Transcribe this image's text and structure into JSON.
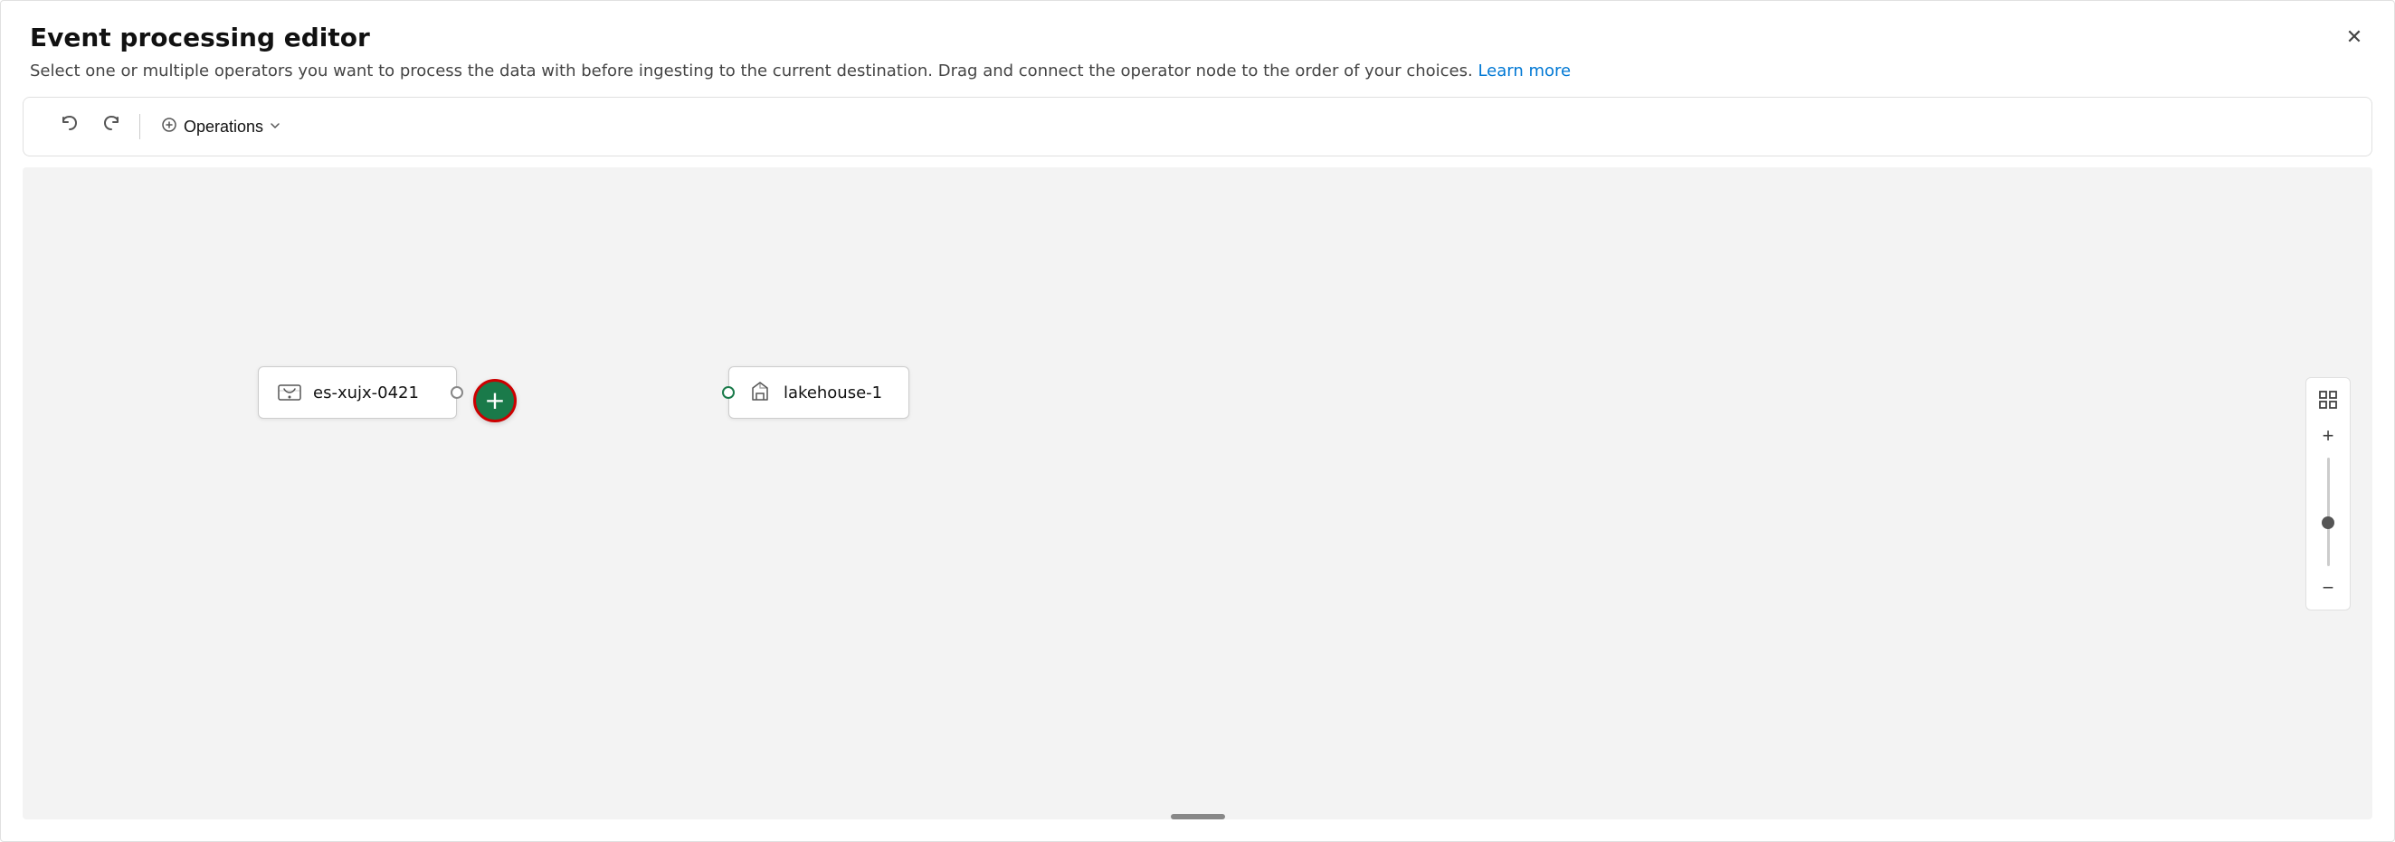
{
  "dialog": {
    "title": "Event processing editor",
    "subtitle": "Select one or multiple operators you want to process the data with before ingesting to the current destination. Drag and connect the operator node to the order of your choices.",
    "learn_more_text": "Learn more",
    "close_label": "×"
  },
  "toolbar": {
    "undo_label": "↩",
    "redo_label": "↪",
    "operations_label": "Operations",
    "operations_chevron": "∨"
  },
  "canvas": {
    "source_node": {
      "label": "es-xujx-0421"
    },
    "destination_node": {
      "label": "lakehouse-1"
    },
    "add_button_title": "Add operation"
  },
  "zoom": {
    "fit_title": "Fit to screen",
    "zoom_in_label": "+",
    "zoom_out_label": "−"
  },
  "colors": {
    "accent": "#0078d4",
    "add_button_bg": "#1a7a4a",
    "add_button_border": "#cc0000",
    "port_color": "#1a7a4a"
  }
}
